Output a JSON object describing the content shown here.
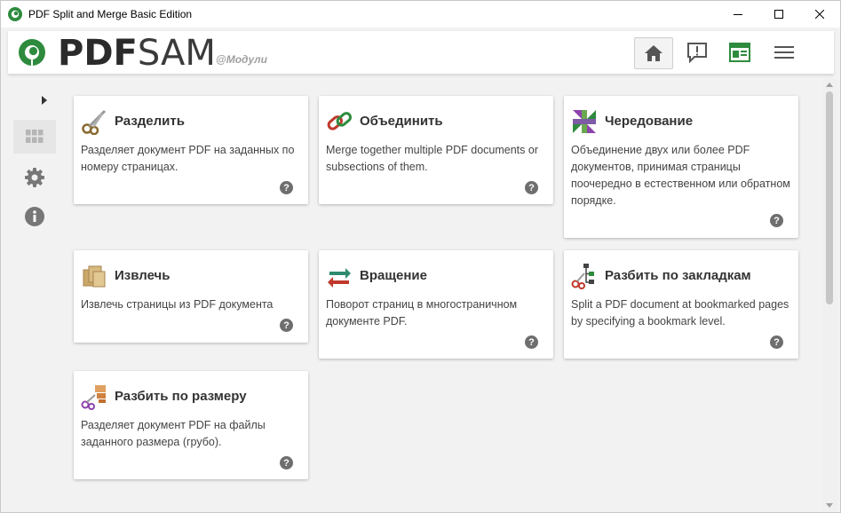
{
  "window": {
    "title": "PDF Split and Merge Basic Edition"
  },
  "header": {
    "logo_text_bold": "PDF",
    "logo_text_light": "SAM",
    "logo_subtitle": "@Модули"
  },
  "colors": {
    "brand_green": "#2e8b3e",
    "card_bg": "#ffffff",
    "page_bg": "#f2f2f2"
  },
  "modules": [
    {
      "title": "Разделить",
      "description": "Разделяет документ PDF на заданных по номеру страницах.",
      "icon": "scissors-icon",
      "help": "?"
    },
    {
      "title": "Объединить",
      "description": "Merge together multiple PDF documents or subsections of them.",
      "icon": "chain-link-icon",
      "help": "?"
    },
    {
      "title": "Чередование",
      "description": "Объединение двух или более PDF документов, принимая страницы поочередно в естественном или обратном порядке.",
      "icon": "alternate-mix-icon",
      "help": "?"
    },
    {
      "title": "Извлечь",
      "description": "Извлечь страницы из PDF документа",
      "icon": "extract-pages-icon",
      "help": "?"
    },
    {
      "title": "Вращение",
      "description": "Поворот страниц в многостраничном документе PDF.",
      "icon": "rotate-icon",
      "help": "?"
    },
    {
      "title": "Разбить по закладкам",
      "description": "Split a PDF document at bookmarked pages by specifying a bookmark level.",
      "icon": "bookmark-split-icon",
      "help": "?"
    },
    {
      "title": "Разбить по размеру",
      "description": "Разделяет документ PDF на файлы заданного размера (грубо).",
      "icon": "size-split-icon",
      "help": "?"
    }
  ]
}
